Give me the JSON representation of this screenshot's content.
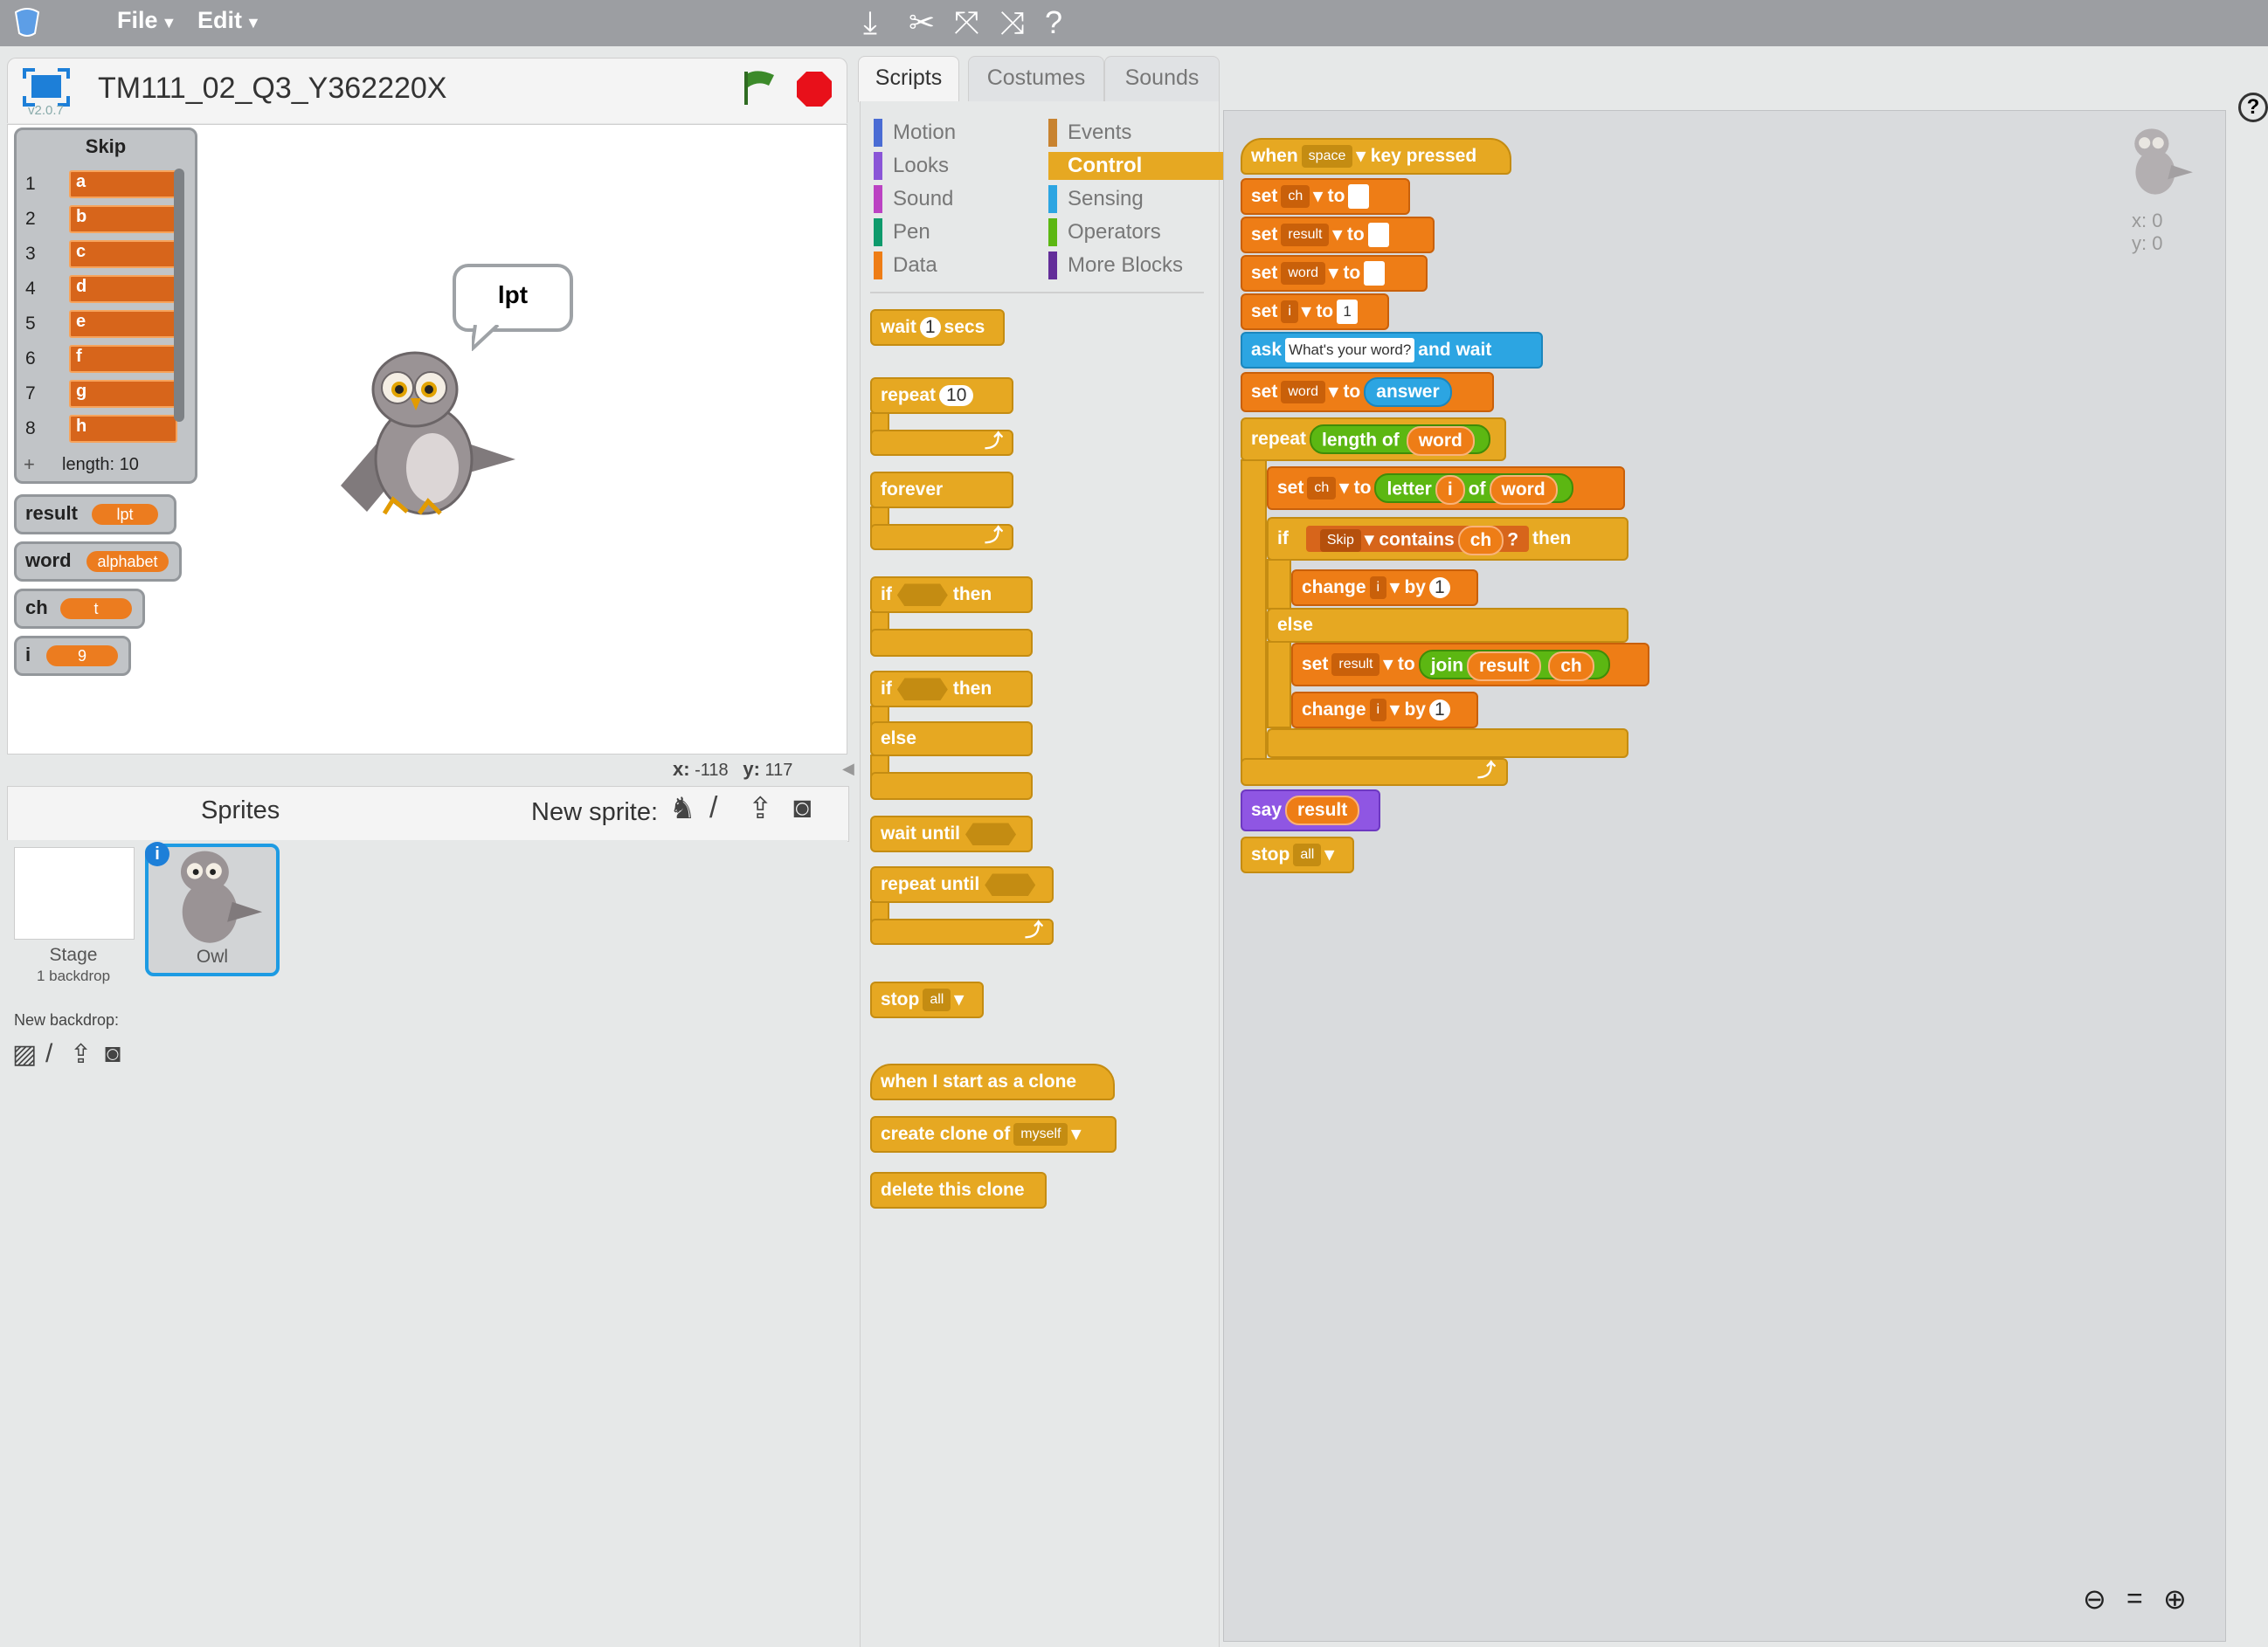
{
  "menu": {
    "file": "File",
    "edit": "Edit"
  },
  "project": {
    "title": "TM111_02_Q3_Y362220X",
    "version": "v2.0.7"
  },
  "list_monitor": {
    "name": "Skip",
    "items": [
      {
        "index": "1",
        "value": "a"
      },
      {
        "index": "2",
        "value": "b"
      },
      {
        "index": "3",
        "value": "c"
      },
      {
        "index": "4",
        "value": "d"
      },
      {
        "index": "5",
        "value": "e"
      },
      {
        "index": "6",
        "value": "f"
      },
      {
        "index": "7",
        "value": "g"
      },
      {
        "index": "8",
        "value": "h"
      }
    ],
    "length_label": "length: 10"
  },
  "variables": [
    {
      "name": "result",
      "value": "lpt"
    },
    {
      "name": "word",
      "value": "alphabet"
    },
    {
      "name": "ch",
      "value": "t"
    },
    {
      "name": "i",
      "value": "9"
    }
  ],
  "speech_bubble": "lpt",
  "stage_coords": {
    "x_label": "x:",
    "x": "-118",
    "y_label": "y:",
    "y": "117"
  },
  "corral": {
    "sprites_label": "Sprites",
    "new_sprite_label": "New sprite:",
    "stage_label": "Stage",
    "stage_sub": "1 backdrop",
    "new_backdrop_label": "New backdrop:",
    "sprite_name": "Owl"
  },
  "tabs": [
    "Scripts",
    "Costumes",
    "Sounds"
  ],
  "categories": [
    {
      "label": "Motion",
      "color": "#4a6cd4"
    },
    {
      "label": "Events",
      "color": "#c88330"
    },
    {
      "label": "Looks",
      "color": "#8a55d7"
    },
    {
      "label": "Control",
      "color": "#e1a91a"
    },
    {
      "label": "Sound",
      "color": "#bb42c3"
    },
    {
      "label": "Sensing",
      "color": "#2ca5e2"
    },
    {
      "label": "Pen",
      "color": "#0e9a6c"
    },
    {
      "label": "Operators",
      "color": "#5cb712"
    },
    {
      "label": "Data",
      "color": "#ee7d16"
    },
    {
      "label": "More Blocks",
      "color": "#632d99"
    }
  ],
  "palette": {
    "wait": "wait",
    "wait_num": "1",
    "wait_secs": "secs",
    "repeat": "repeat",
    "repeat_num": "10",
    "forever": "forever",
    "if": "if",
    "then": "then",
    "else": "else",
    "wait_until": "wait until",
    "repeat_until": "repeat until",
    "stop": "stop",
    "stop_opt": "all",
    "when_clone": "when I start as a clone",
    "create_clone": "create clone of",
    "clone_opt": "myself",
    "delete_clone": "delete this clone"
  },
  "script": {
    "when": "when",
    "key": "space",
    "key_pressed": "key pressed",
    "set": "set",
    "to": "to",
    "var_ch": "ch",
    "var_result": "result",
    "var_word": "word",
    "var_i": "i",
    "one": "1",
    "ask": "ask",
    "ask_text": "What's your word?",
    "and_wait": "and wait",
    "answer": "answer",
    "repeat": "repeat",
    "length_of": "length of",
    "letter": "letter",
    "of": "of",
    "if": "if",
    "list_skip": "Skip",
    "contains": "contains",
    "q": "?",
    "then": "then",
    "change": "change",
    "by": "by",
    "else": "else",
    "join": "join",
    "say": "say",
    "stop": "stop",
    "stop_opt": "all"
  },
  "script_coords": {
    "x": "x: 0",
    "y": "y: 0"
  },
  "colors": {
    "control": "#e6a822",
    "data": "#ee7d16",
    "sensing": "#2ca5e2",
    "operators": "#5cb712",
    "looks": "#8f56e3",
    "selection": "#1d9be3"
  }
}
